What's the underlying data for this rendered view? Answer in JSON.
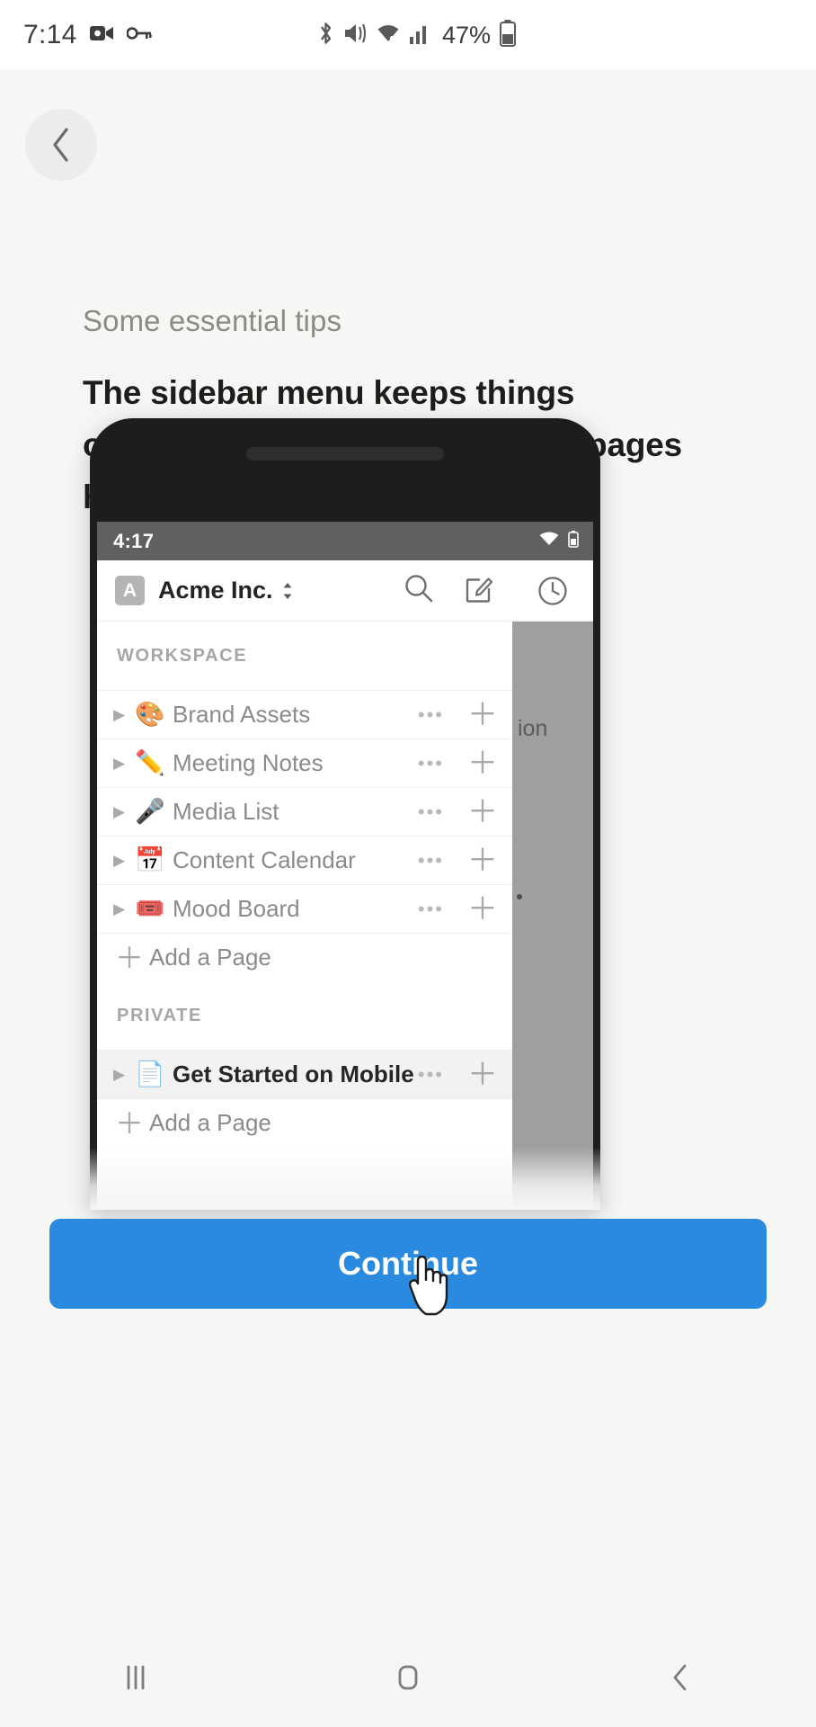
{
  "os_status_bar": {
    "clock": "7:14",
    "battery_percent": "47%",
    "left_icons": [
      "video-camera-icon",
      "key-icon"
    ],
    "right_icons": [
      "bluetooth-icon",
      "mute-vibrate-icon",
      "wifi-icon",
      "cellular-signal-icon",
      "battery-icon"
    ]
  },
  "onboarding": {
    "back_label": "‹",
    "eyebrow": "Some essential tips",
    "headline": "The sidebar menu keeps things organized. You’ll find all of your pages here.",
    "continue_label": "Continue",
    "accent_color": "#2a8ae0"
  },
  "phone_mockup": {
    "status": {
      "clock": "4:17",
      "icons": [
        "wifi-icon",
        "battery-icon"
      ]
    },
    "drawer": {
      "workspace_initial": "A",
      "workspace_name": "Acme Inc.",
      "header_icons": [
        "search-icon",
        "compose-icon",
        "history-clock-icon"
      ],
      "sections": [
        {
          "label": "WORKSPACE",
          "pages": [
            {
              "emoji": "🎨",
              "emoji_name": "artist-palette-emoji",
              "title": "Brand Assets",
              "highlight": false
            },
            {
              "emoji": "✏️",
              "emoji_name": "pencil-emoji",
              "title": "Meeting Notes",
              "highlight": false
            },
            {
              "emoji": "🎤",
              "emoji_name": "microphone-emoji",
              "title": "Media List",
              "highlight": false
            },
            {
              "emoji": "📅",
              "emoji_name": "calendar-emoji",
              "title": "Content Calendar",
              "highlight": false
            },
            {
              "emoji": "🎟️",
              "emoji_name": "admit-one-ticket-emoji",
              "title": "Mood Board",
              "highlight": false
            }
          ],
          "add_label": "Add a Page"
        },
        {
          "label": "PRIVATE",
          "pages": [
            {
              "emoji": "📄",
              "emoji_name": "page-document-emoji",
              "title": "Get Started on Mobile",
              "highlight": true
            }
          ],
          "add_label": "Add a Page"
        }
      ]
    },
    "scrim_text": "ion"
  },
  "android_nav": {
    "recents_label": "recents-button",
    "home_label": "home-button",
    "back_label": "back-button"
  }
}
